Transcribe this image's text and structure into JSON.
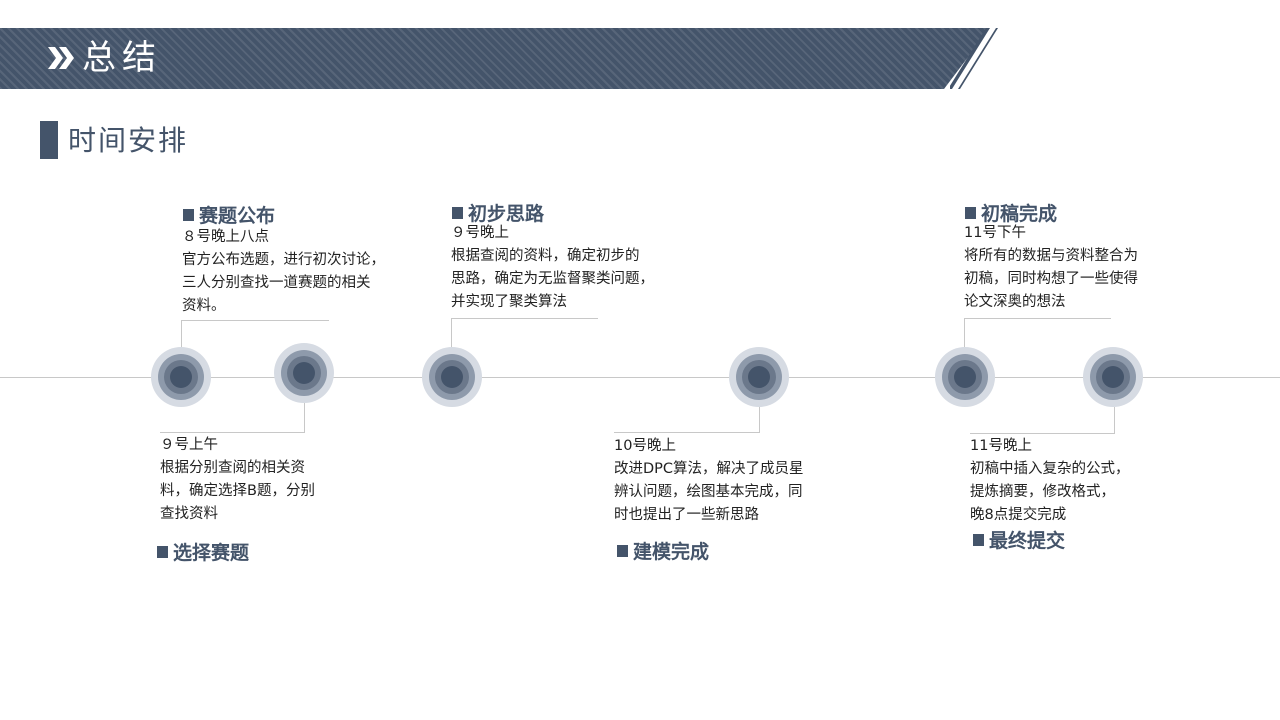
{
  "header": {
    "title": "总结"
  },
  "section": {
    "title": "时间安排"
  },
  "timeline": [
    {
      "title": "赛题公布",
      "date": "８号晚上八点",
      "lines": [
        "官方公布选题，进行初次讨论，",
        "三人分别查找一道赛题的相关",
        "资料。"
      ]
    },
    {
      "title": "选择赛题",
      "date": "９号上午",
      "lines": [
        "根据分别查阅的相关资",
        "料，确定选择B题，分别",
        "查找资料"
      ]
    },
    {
      "title": "初步思路",
      "date": "９号晚上",
      "lines": [
        "根据查阅的资料，确定初步的",
        "思路，确定为无监督聚类问题，",
        "并实现了聚类算法"
      ]
    },
    {
      "title": "建模完成",
      "date": "10号晚上",
      "lines": [
        "改进DPC算法，解决了成员星",
        "辨认问题，绘图基本完成，同",
        "时也提出了一些新思路"
      ]
    },
    {
      "title": "初稿完成",
      "date": "11号下午",
      "lines": [
        "将所有的数据与资料整合为",
        "初稿，同时构想了一些使得",
        "论文深奥的想法"
      ]
    },
    {
      "title": "最终提交",
      "date": "11号晚上",
      "lines": [
        "初稿中插入复杂的公式，",
        "提炼摘要，修改格式，",
        "晚8点提交完成"
      ]
    }
  ],
  "colors": {
    "accent": "#44546a",
    "ring_light": "#d6dbe3",
    "ring_mid": "#8e9aab",
    "line": "#c8c8c8"
  },
  "icons": {
    "header_marker": "double-chevron-right-icon"
  }
}
